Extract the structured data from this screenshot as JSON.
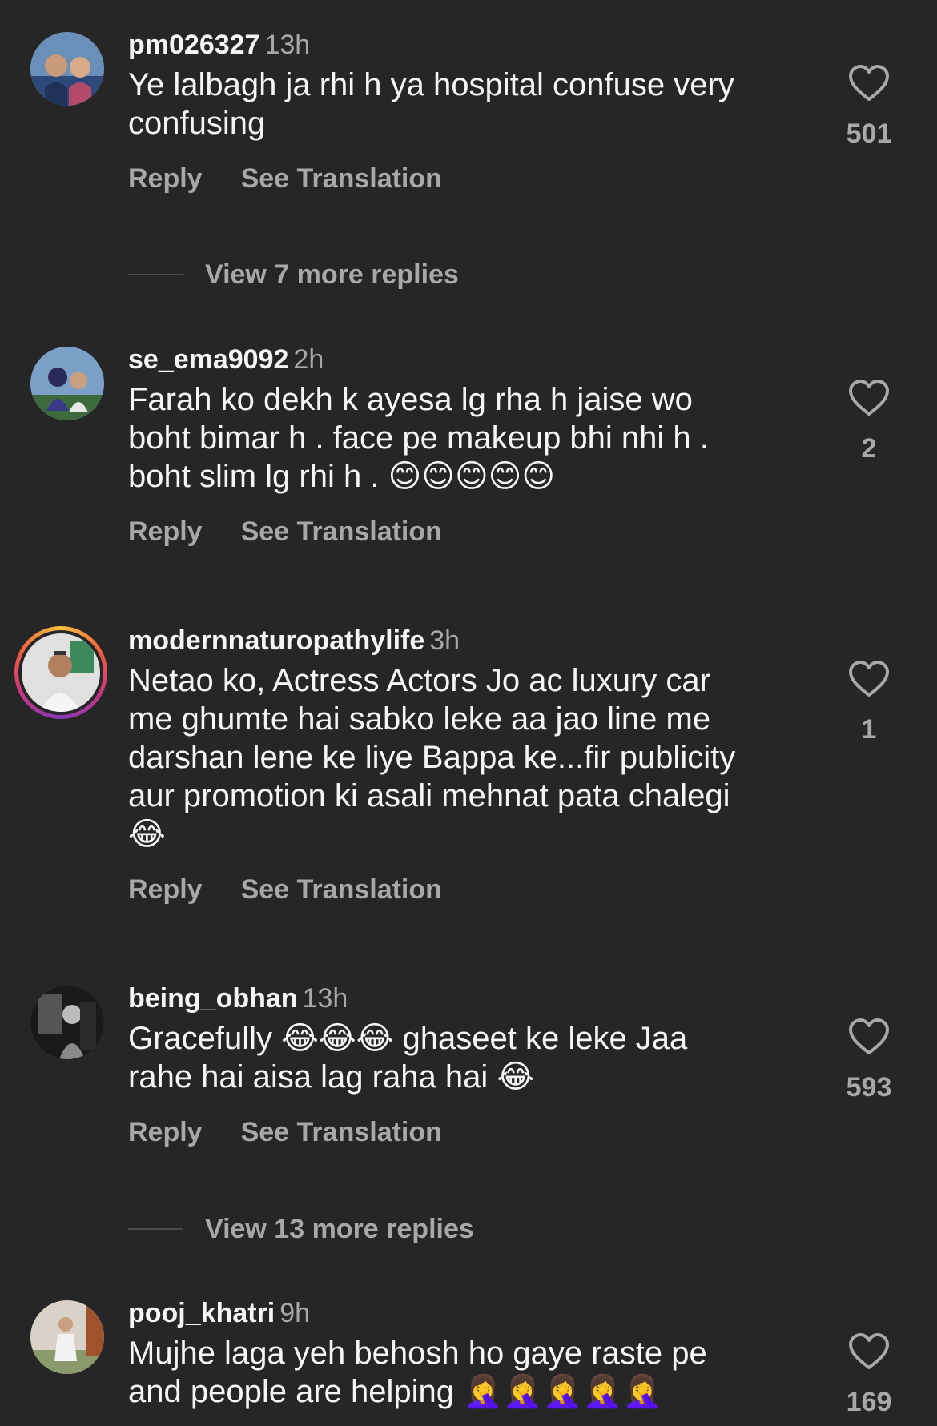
{
  "comments": [
    {
      "username": "pm026327",
      "time": "13h",
      "text": "Ye lalbagh ja rhi h ya hospital confuse very\nconfusing",
      "likes": "501",
      "reply": "Reply",
      "translate": "See Translation"
    },
    {
      "username": "se_ema9092",
      "time": "2h",
      "text": "Farah ko dekh k ayesa lg rha h jaise wo\nboht bimar h . face pe makeup bhi nhi h .\nboht slim lg rhi h . 😊😊😊😊😊",
      "likes": "2",
      "reply": "Reply",
      "translate": "See Translation"
    },
    {
      "username": "modernnaturopathylife",
      "time": "3h",
      "text": "Netao ko, Actress Actors Jo ac luxury car\nme ghumte hai sabko leke aa jao line me\ndarshan lene ke liye Bappa ke...fir publicity\naur promotion ki asali mehnat pata chalegi\n😂",
      "likes": "1",
      "reply": "Reply",
      "translate": "See Translation"
    },
    {
      "username": "being_obhan",
      "time": "13h",
      "text": "Gracefully 😂😂😂 ghaseet ke leke Jaa\nrahe hai aisa lag raha hai 😂",
      "likes": "593",
      "reply": "Reply",
      "translate": "See Translation"
    },
    {
      "username": "pooj_khatri",
      "time": "9h",
      "text": "Mujhe laga yeh behosh ho gaye raste pe\nand people are helping 🤦‍♀️🤦‍♀️🤦‍♀️🤦‍♀️🤦‍♀️",
      "likes": "169"
    }
  ],
  "view_more": [
    "View 7 more replies",
    "View 13 more replies"
  ],
  "icons": {
    "like": "heart-outline-icon"
  },
  "colors": {
    "background": "#262626",
    "text": "#f5f5f5",
    "muted": "#a8a8a8"
  }
}
